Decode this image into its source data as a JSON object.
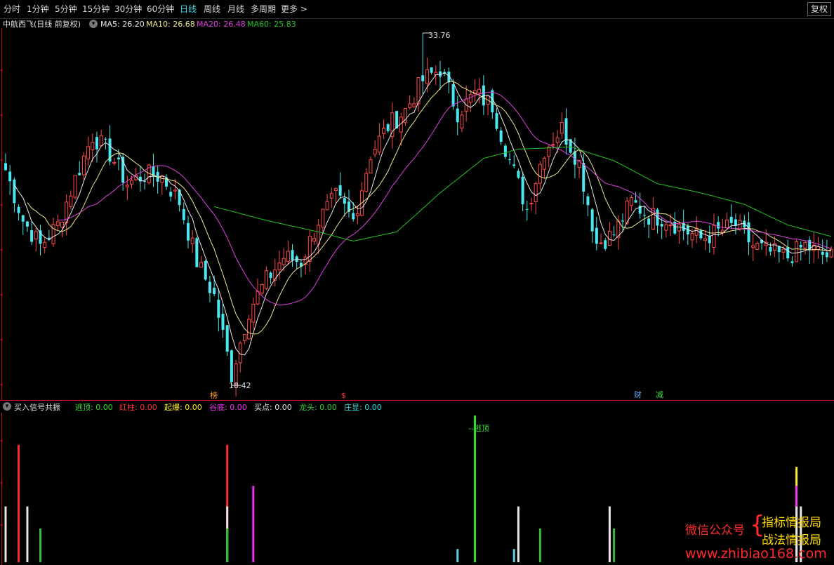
{
  "toolbar": {
    "tabs": [
      "分时",
      "1分钟",
      "5分钟",
      "15分钟",
      "30分钟",
      "60分钟",
      "日线",
      "周线",
      "月线",
      "多周期",
      "更多 >"
    ],
    "active_tab": "日线",
    "right_button": "复权"
  },
  "main_legend": {
    "stock": "中航西飞(日线 前复权)",
    "ma5": "MA5: 26.20",
    "ma10": "MA10: 26.68",
    "ma20": "MA20: 26.48",
    "ma60": "MA60: 25.83",
    "colors": {
      "ma5": "#e8e8e8",
      "ma10": "#f0e68c",
      "ma20": "#e040e0",
      "ma60": "#22c322",
      "up": "#ff4a4a",
      "down": "#4ae8f0"
    }
  },
  "main_chart": {
    "high_label": "33.76",
    "low_label": "18.42",
    "markers": [
      {
        "text": "榜",
        "color": "#ff9a2a"
      },
      {
        "text": "$",
        "color": "#ff3030"
      },
      {
        "text": "财",
        "color": "#66a8ff"
      },
      {
        "text": "减",
        "color": "#44dd44"
      }
    ]
  },
  "indicator": {
    "title": "买入信号共振",
    "items": [
      {
        "label": "逃顶: 0.00",
        "color": "#33dd33"
      },
      {
        "label": "红柱: 0.00",
        "color": "#ff3333"
      },
      {
        "label": "起爆: 0.00",
        "color": "#ffee33"
      },
      {
        "label": "谷底: 0.00",
        "color": "#ee33ee"
      },
      {
        "label": "买点: 0.00",
        "color": "#e8e8e8"
      },
      {
        "label": "龙头: 0.00",
        "color": "#33cc33"
      },
      {
        "label": "庄显: 0.00",
        "color": "#33e0e0"
      }
    ],
    "annotation": "逃顶"
  },
  "watermark": {
    "wechat": "微信公众号",
    "brace": "{",
    "name1": "指标情报局",
    "name2": "战法情报局",
    "url": "www.zhibiao168.com"
  },
  "chart_data": {
    "type": "candlestick",
    "ylim": [
      18.42,
      33.76
    ],
    "anchors": [
      {
        "i": 0,
        "v": 27.8
      },
      {
        "i": 4,
        "v": 25.6
      },
      {
        "i": 8,
        "v": 24.5
      },
      {
        "i": 12,
        "v": 25.4
      },
      {
        "i": 16,
        "v": 27.4
      },
      {
        "i": 20,
        "v": 29.3
      },
      {
        "i": 24,
        "v": 28.5
      },
      {
        "i": 28,
        "v": 27.2
      },
      {
        "i": 32,
        "v": 27.6
      },
      {
        "i": 36,
        "v": 27.5
      },
      {
        "i": 40,
        "v": 26.4
      },
      {
        "i": 44,
        "v": 23.8
      },
      {
        "i": 48,
        "v": 22.3
      },
      {
        "i": 52,
        "v": 18.9
      },
      {
        "i": 56,
        "v": 21.7
      },
      {
        "i": 60,
        "v": 23.0
      },
      {
        "i": 64,
        "v": 24.0
      },
      {
        "i": 68,
        "v": 23.8
      },
      {
        "i": 72,
        "v": 25.6
      },
      {
        "i": 76,
        "v": 26.6
      },
      {
        "i": 80,
        "v": 25.6
      },
      {
        "i": 84,
        "v": 28.5
      },
      {
        "i": 88,
        "v": 29.7
      },
      {
        "i": 92,
        "v": 30.4
      },
      {
        "i": 96,
        "v": 31.7
      },
      {
        "i": 100,
        "v": 32.2
      },
      {
        "i": 104,
        "v": 30.3
      },
      {
        "i": 108,
        "v": 31.1
      },
      {
        "i": 112,
        "v": 30.6
      },
      {
        "i": 116,
        "v": 28.2
      },
      {
        "i": 120,
        "v": 26.1
      },
      {
        "i": 124,
        "v": 28.7
      },
      {
        "i": 128,
        "v": 29.6
      },
      {
        "i": 132,
        "v": 28.1
      },
      {
        "i": 136,
        "v": 24.6
      },
      {
        "i": 140,
        "v": 25.0
      },
      {
        "i": 144,
        "v": 26.4
      },
      {
        "i": 148,
        "v": 25.8
      },
      {
        "i": 152,
        "v": 25.7
      },
      {
        "i": 156,
        "v": 25.2
      },
      {
        "i": 160,
        "v": 24.8
      },
      {
        "i": 164,
        "v": 25.1
      },
      {
        "i": 168,
        "v": 25.4
      },
      {
        "i": 172,
        "v": 24.5
      },
      {
        "i": 176,
        "v": 24.2
      },
      {
        "i": 180,
        "v": 24.0
      },
      {
        "i": 184,
        "v": 24.5
      },
      {
        "i": 188,
        "v": 24.1
      },
      {
        "i": 190,
        "v": 24.0
      }
    ],
    "ma60_anchors": [
      {
        "i": 48,
        "v": 26.2
      },
      {
        "i": 60,
        "v": 25.6
      },
      {
        "i": 72,
        "v": 25.1
      },
      {
        "i": 80,
        "v": 24.7
      },
      {
        "i": 90,
        "v": 25.1
      },
      {
        "i": 100,
        "v": 26.8
      },
      {
        "i": 110,
        "v": 28.3
      },
      {
        "i": 118,
        "v": 28.7
      },
      {
        "i": 130,
        "v": 28.8
      },
      {
        "i": 140,
        "v": 28.2
      },
      {
        "i": 150,
        "v": 27.2
      },
      {
        "i": 160,
        "v": 26.8
      },
      {
        "i": 170,
        "v": 26.3
      },
      {
        "i": 180,
        "v": 25.4
      },
      {
        "i": 190,
        "v": 24.9
      }
    ],
    "signal_bars": [
      {
        "i": 0,
        "color": "#e8e8e8",
        "v": 0.38
      },
      {
        "i": 3,
        "color": "#ff2a2a",
        "v": 0.8
      },
      {
        "i": 5,
        "color": "#e8e8e8",
        "v": 0.38
      },
      {
        "i": 8,
        "color": "#33bb33",
        "v": 0.23
      },
      {
        "i": 51,
        "color": "#ff2a2a",
        "v": 0.8
      },
      {
        "i": 51,
        "color": "#e8e8e8",
        "v": 0.38
      },
      {
        "i": 51,
        "color": "#33bb33",
        "v": 0.23
      },
      {
        "i": 57,
        "color": "#ee33ee",
        "v": 0.52
      },
      {
        "i": 104,
        "color": "#66ccdd",
        "v": 0.09
      },
      {
        "i": 108,
        "color": "#33dd33",
        "v": 1.0
      },
      {
        "i": 117,
        "color": "#66ccdd",
        "v": 0.09
      },
      {
        "i": 118,
        "color": "#e8e8e8",
        "v": 0.38
      },
      {
        "i": 123,
        "color": "#33bb33",
        "v": 0.23
      },
      {
        "i": 139,
        "color": "#e8e8e8",
        "v": 0.38
      },
      {
        "i": 140,
        "color": "#33bb33",
        "v": 0.23
      },
      {
        "i": 182,
        "color": "#ffee33",
        "v": 0.65
      },
      {
        "i": 182,
        "color": "#ee33ee",
        "v": 0.52
      },
      {
        "i": 182,
        "color": "#e8e8e8",
        "v": 0.38
      },
      {
        "i": 183,
        "color": "#e8e8e8",
        "v": 0.38
      }
    ]
  }
}
